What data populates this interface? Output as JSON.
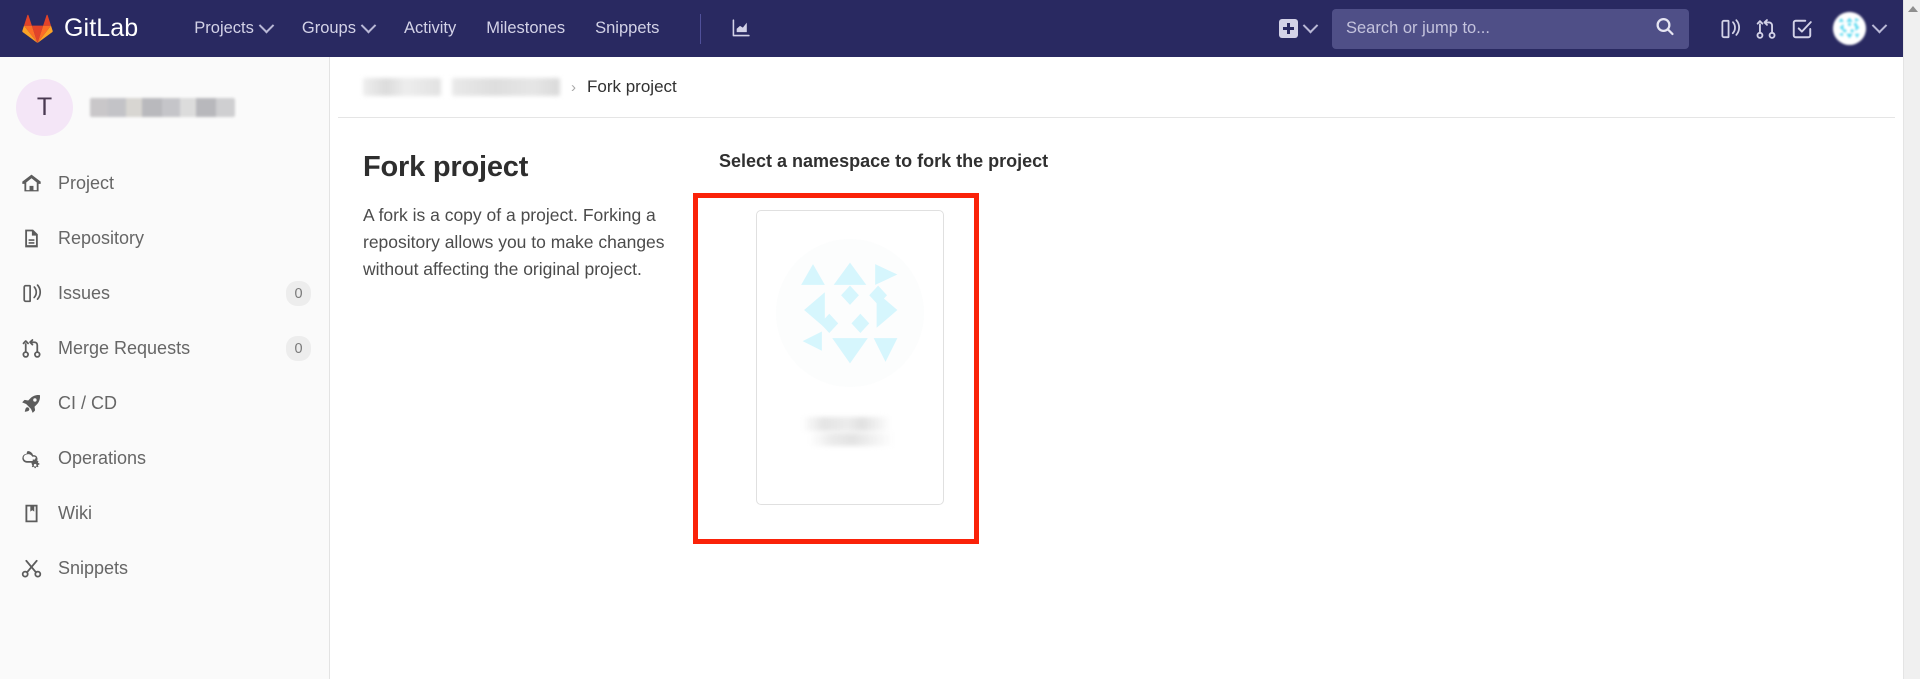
{
  "navbar": {
    "brand": "GitLab",
    "brand_logo_icon": "gitlab-tanuki-logo",
    "links": [
      {
        "label": "Projects",
        "has_chevron": true
      },
      {
        "label": "Groups",
        "has_chevron": true
      },
      {
        "label": "Activity",
        "has_chevron": false
      },
      {
        "label": "Milestones",
        "has_chevron": false
      },
      {
        "label": "Snippets",
        "has_chevron": false
      }
    ],
    "analytics_icon": "chart-icon",
    "new_dropdown": {
      "icon": "plus-square-icon",
      "chevron": "chevron-down-icon"
    },
    "search": {
      "placeholder": "Search or jump to...",
      "value": "",
      "icon": "search-icon"
    },
    "right_icons": [
      {
        "name": "issues-icon"
      },
      {
        "name": "merge-requests-icon"
      },
      {
        "name": "todos-done-icon"
      }
    ],
    "avatar": {
      "icon": "user-avatar-identicon",
      "chevron": "chevron-down-icon"
    },
    "background_color": "#292961"
  },
  "sidebar": {
    "project": {
      "avatar_letter": "T",
      "avatar_color": "#f4e6f7",
      "name_redacted": true
    },
    "items": [
      {
        "label": "Project",
        "icon": "home-icon",
        "badge": ""
      },
      {
        "label": "Repository",
        "icon": "document-icon",
        "badge": ""
      },
      {
        "label": "Issues",
        "icon": "issues-icon",
        "badge": "0"
      },
      {
        "label": "Merge Requests",
        "icon": "merge-requests-icon",
        "badge": "0"
      },
      {
        "label": "CI / CD",
        "icon": "rocket-icon",
        "badge": ""
      },
      {
        "label": "Operations",
        "icon": "operations-gear-icon",
        "badge": ""
      },
      {
        "label": "Wiki",
        "icon": "book-icon",
        "badge": ""
      },
      {
        "label": "Snippets",
        "icon": "snippet-scissors-icon",
        "badge": ""
      }
    ]
  },
  "breadcrumb": {
    "redacted_items": 2,
    "separator": "›",
    "current": "Fork project"
  },
  "main": {
    "title": "Fork project",
    "description": "A fork is a copy of a project. Forking a repository allows you to make changes without affecting the original project.",
    "namespace_section_title": "Select a namespace to fork the project",
    "namespaces": [
      {
        "avatar_icon": "identicon-avatar",
        "name_redacted": true
      }
    ]
  },
  "annotation": {
    "highlight_color": "#fa2209",
    "target": "namespace-selection-area"
  },
  "scrollbar": {
    "up_arrow_icon": "scroll-up-arrow-icon",
    "track_color": "#f0f0f0"
  }
}
